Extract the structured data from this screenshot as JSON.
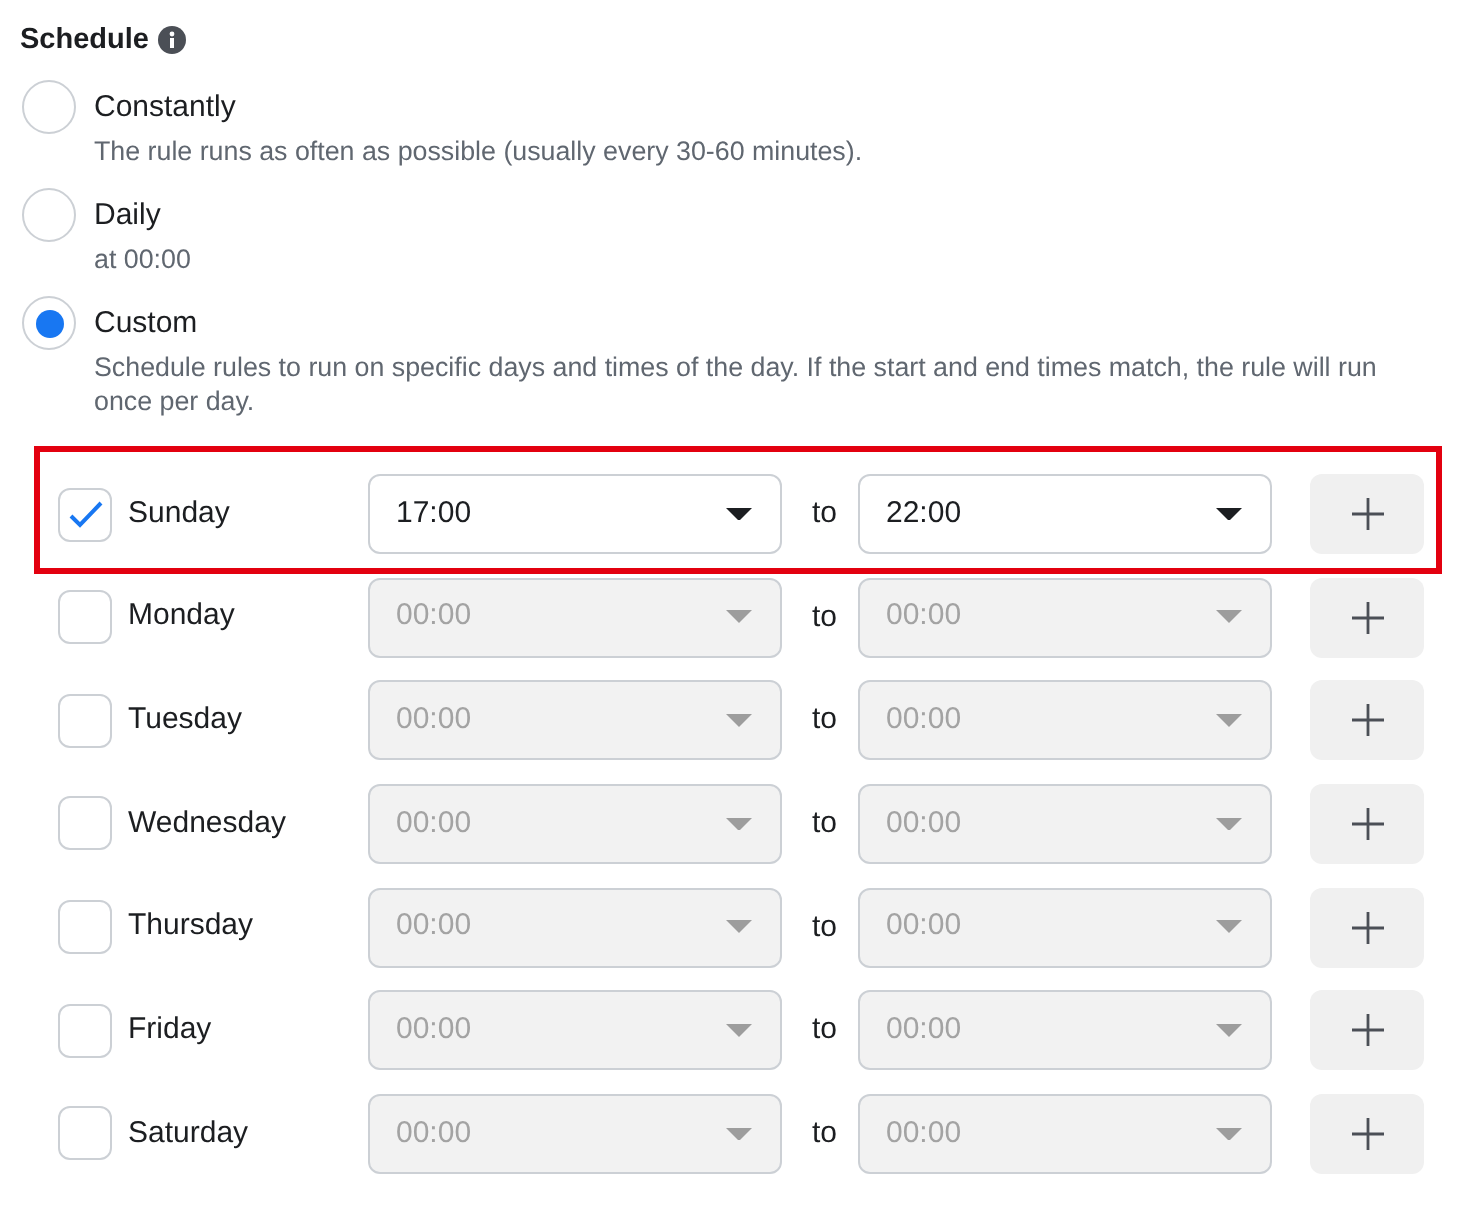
{
  "section": {
    "title": "Schedule"
  },
  "options": [
    {
      "label": "Constantly",
      "description": "The rule runs as often as possible (usually every 30-60 minutes).",
      "selected": false
    },
    {
      "label": "Daily",
      "description": "at 00:00",
      "selected": false
    },
    {
      "label": "Custom",
      "description": "Schedule rules to run on specific days and times of the day. If the start and end times match, the rule will run once per day.",
      "selected": true
    }
  ],
  "days": [
    {
      "label": "Sunday",
      "checked": true,
      "highlighted": true,
      "disabled": false,
      "start": "17:00",
      "separator": "to",
      "end": "22:00"
    },
    {
      "label": "Monday",
      "checked": false,
      "highlighted": false,
      "disabled": true,
      "start": "00:00",
      "separator": "to",
      "end": "00:00"
    },
    {
      "label": "Tuesday",
      "checked": false,
      "highlighted": false,
      "disabled": true,
      "start": "00:00",
      "separator": "to",
      "end": "00:00"
    },
    {
      "label": "Wednesday",
      "checked": false,
      "highlighted": false,
      "disabled": true,
      "start": "00:00",
      "separator": "to",
      "end": "00:00"
    },
    {
      "label": "Thursday",
      "checked": false,
      "highlighted": false,
      "disabled": true,
      "start": "00:00",
      "separator": "to",
      "end": "00:00"
    },
    {
      "label": "Friday",
      "checked": false,
      "highlighted": false,
      "disabled": true,
      "start": "00:00",
      "separator": "to",
      "end": "00:00"
    },
    {
      "label": "Saturday",
      "checked": false,
      "highlighted": false,
      "disabled": true,
      "start": "00:00",
      "separator": "to",
      "end": "00:00"
    }
  ]
}
